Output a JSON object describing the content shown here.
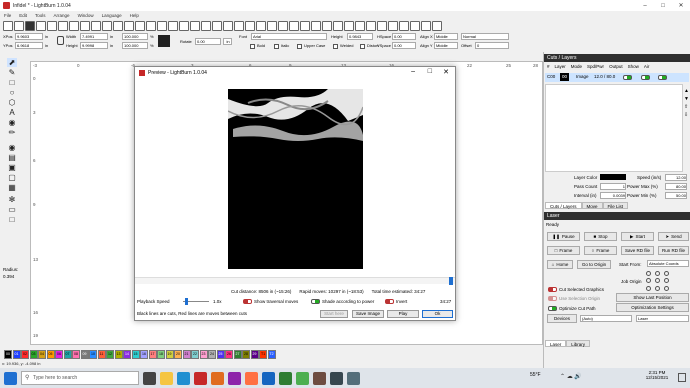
{
  "window": {
    "title": "Infidel * - LightBurn 1.0.04"
  },
  "menu": [
    "File",
    "Edit",
    "Tools",
    "Arrange",
    "Window",
    "Language",
    "Help"
  ],
  "props": {
    "xpos_label": "XPos",
    "xpos": "9.9603",
    "ypos_label": "YPos",
    "ypos": "6.9618",
    "unit_in": "in",
    "width_label": "Width",
    "width": "7.4991",
    "height_label": "Height",
    "height": "9.9998",
    "wpct": "100.000",
    "hpct": "100.000",
    "pct": "%",
    "rotate_label": "Rotate",
    "rotate": "0.00",
    "mm_btn": "in",
    "font_label": "Font",
    "font": "Arial",
    "fheight_label": "Height",
    "fheight": "0.9843",
    "hspace_label": "HSpace",
    "hspace": "0.00",
    "vspace_label": "VSpace",
    "vspace": "0.00",
    "alignx_label": "Align X",
    "alignx": "Middle",
    "aligny_label": "Align Y",
    "aligny": "Middle",
    "normal": "Normal",
    "offset_label": "Offset",
    "offset": "0",
    "bold": "Bold",
    "italic": "Italic",
    "upper": "Upper Case",
    "welded": "Welded",
    "distort": "Distort"
  },
  "ruler": {
    "top": [
      "-3",
      "0",
      "-6",
      "3",
      "6",
      "9",
      "13",
      "16",
      "22",
      "25",
      "28"
    ],
    "left": [
      "0",
      "3",
      "6",
      "9",
      "13",
      "16",
      "19"
    ]
  },
  "palette": [
    "00",
    "01",
    "02",
    "03",
    "04",
    "05",
    "06",
    "07",
    "08",
    "09",
    "10",
    "11",
    "12",
    "13",
    "14",
    "15",
    "16",
    "17",
    "18",
    "19",
    "20",
    "21",
    "22",
    "23",
    "24",
    "25",
    "26",
    "27",
    "28",
    "29",
    "T1",
    "T2"
  ],
  "palette_colors": [
    "#000000",
    "#1f3fff",
    "#ff2a2a",
    "#2aa52a",
    "#d4a017",
    "#ff9800",
    "#e21fe2",
    "#1fa5a5",
    "#ff6fae",
    "#7a7a7a",
    "#2a8cff",
    "#ff5e3a",
    "#3fa53f",
    "#b0b000",
    "#8a2be2",
    "#2ecfcf",
    "#a0a0ff",
    "#ff7f7f",
    "#7fcf7f",
    "#cfcf3f",
    "#ffb04f",
    "#cf7fcf",
    "#7fcfcf",
    "#ff9fcf",
    "#b0b0b0",
    "#4f2ff0",
    "#ff2f7f",
    "#2f7f2f",
    "#7f7f00",
    "#5a0088",
    "#ff3300",
    "#2a5fff"
  ],
  "statusbar": "x: 19.936, y: -4.098 in",
  "dialog": {
    "title": "Preview - LightBurn 1.0.04",
    "cut_distance": "Cut distance: 8506 in (~15:26)",
    "rapid_moves": "Rapid moves: 10297 in (~18:53)",
    "total_time": "Total time estimated: 34:27",
    "playback_label": "Playback Speed",
    "speed": "1.0x",
    "show_traversal": "Show traversal moves",
    "shade": "Shade according to power",
    "invert": "Invert",
    "time": "34:27",
    "hint": "Black lines are cuts, Red lines are moves between cuts",
    "start_here": "Start here",
    "save_image": "Save Image",
    "play": "Play",
    "ok": "Ok"
  },
  "cuts": {
    "title": "Cuts / Layers",
    "headers": [
      "#",
      "Layer",
      "Mode",
      "Spd/Pwr",
      "Output",
      "Show",
      "Air"
    ],
    "row": {
      "num": "C00",
      "layer": "00",
      "mode": "Image",
      "spdpwr": "12.0 / 80.0"
    },
    "layer_color": "Layer Color",
    "speed_label": "Speed (in/s)",
    "speed": "12.00",
    "pass_label": "Pass Count",
    "pass": "1",
    "pmax_label": "Power Max (%)",
    "pmax": "80.00",
    "interval_label": "Interval (in)",
    "interval": "0.0039",
    "pmin_label": "Power Min (%)",
    "pmin": "50.00"
  },
  "tabs1": [
    "Cuts / Layers",
    "Move",
    "File List"
  ],
  "laser": {
    "title": "Laser",
    "status": "Ready",
    "pause": "Pause",
    "stop": "Stop",
    "start": "Start",
    "send": "Send",
    "frame1": "Frame",
    "frame2": "Frame",
    "save_rd": "Save RD file",
    "run_rd": "Run RD file",
    "home": "Home",
    "goto": "Go to Origin",
    "start_from_label": "Start From:",
    "start_from": "Absolute Coords",
    "job_origin": "Job Origin",
    "cut_selected": "Cut Selected Graphics",
    "use_selection": "Use Selection Origin",
    "show_last": "Show Last Position",
    "optimize_cut": "Optimize Cut Path",
    "optimization": "Optimization Settings",
    "devices": "Devices",
    "auto": "(Auto)",
    "laser_sel": "Laser"
  },
  "tabs2": [
    "Laser",
    "Library"
  ],
  "tray": {
    "search": "Type here to search",
    "temp": "55°F",
    "time": "2:31 PM",
    "date": "12/15/2021"
  },
  "colors": {
    "accent": "#2f2f2f",
    "toggle_on": "#1f8f1f"
  }
}
